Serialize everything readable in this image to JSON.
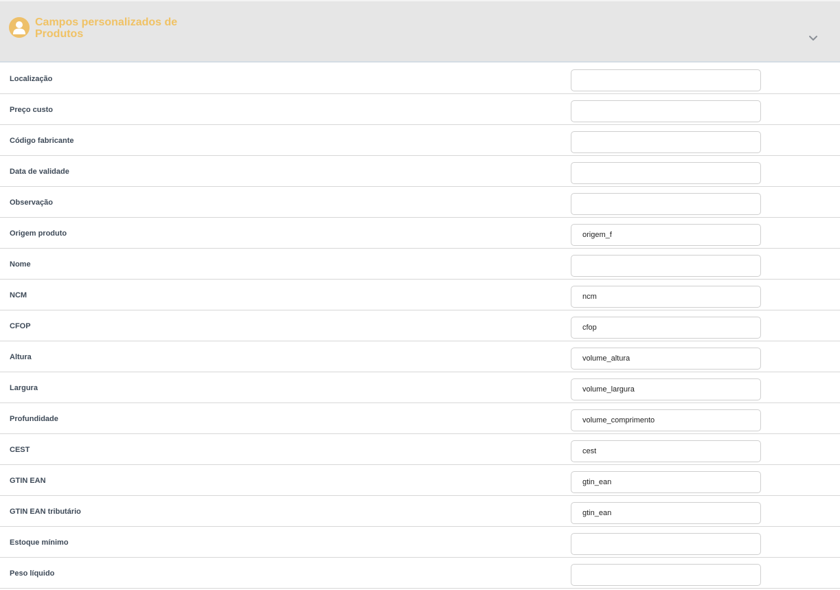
{
  "header": {
    "title": "Campos personalizados de Produtos",
    "avatar_icon": "user-icon",
    "toggle_icon": "chevron-down-icon",
    "title_color": "#f0c265",
    "avatar_color": "#eec06a"
  },
  "fields": [
    {
      "label": "Localização",
      "value": ""
    },
    {
      "label": "Preço custo",
      "value": ""
    },
    {
      "label": "Código fabricante",
      "value": ""
    },
    {
      "label": "Data de validade",
      "value": ""
    },
    {
      "label": "Observação",
      "value": ""
    },
    {
      "label": "Origem produto",
      "value": "origem_f"
    },
    {
      "label": "Nome",
      "value": ""
    },
    {
      "label": "NCM",
      "value": "ncm"
    },
    {
      "label": "CFOP",
      "value": "cfop"
    },
    {
      "label": "Altura",
      "value": "volume_altura"
    },
    {
      "label": "Largura",
      "value": "volume_largura"
    },
    {
      "label": "Profundidade",
      "value": "volume_comprimento"
    },
    {
      "label": "CEST",
      "value": "cest"
    },
    {
      "label": "GTIN EAN",
      "value": "gtin_ean"
    },
    {
      "label": "GTIN EAN tributário",
      "value": "gtin_ean"
    },
    {
      "label": "Estoque mínimo",
      "value": ""
    },
    {
      "label": "Peso líquido",
      "value": ""
    }
  ]
}
